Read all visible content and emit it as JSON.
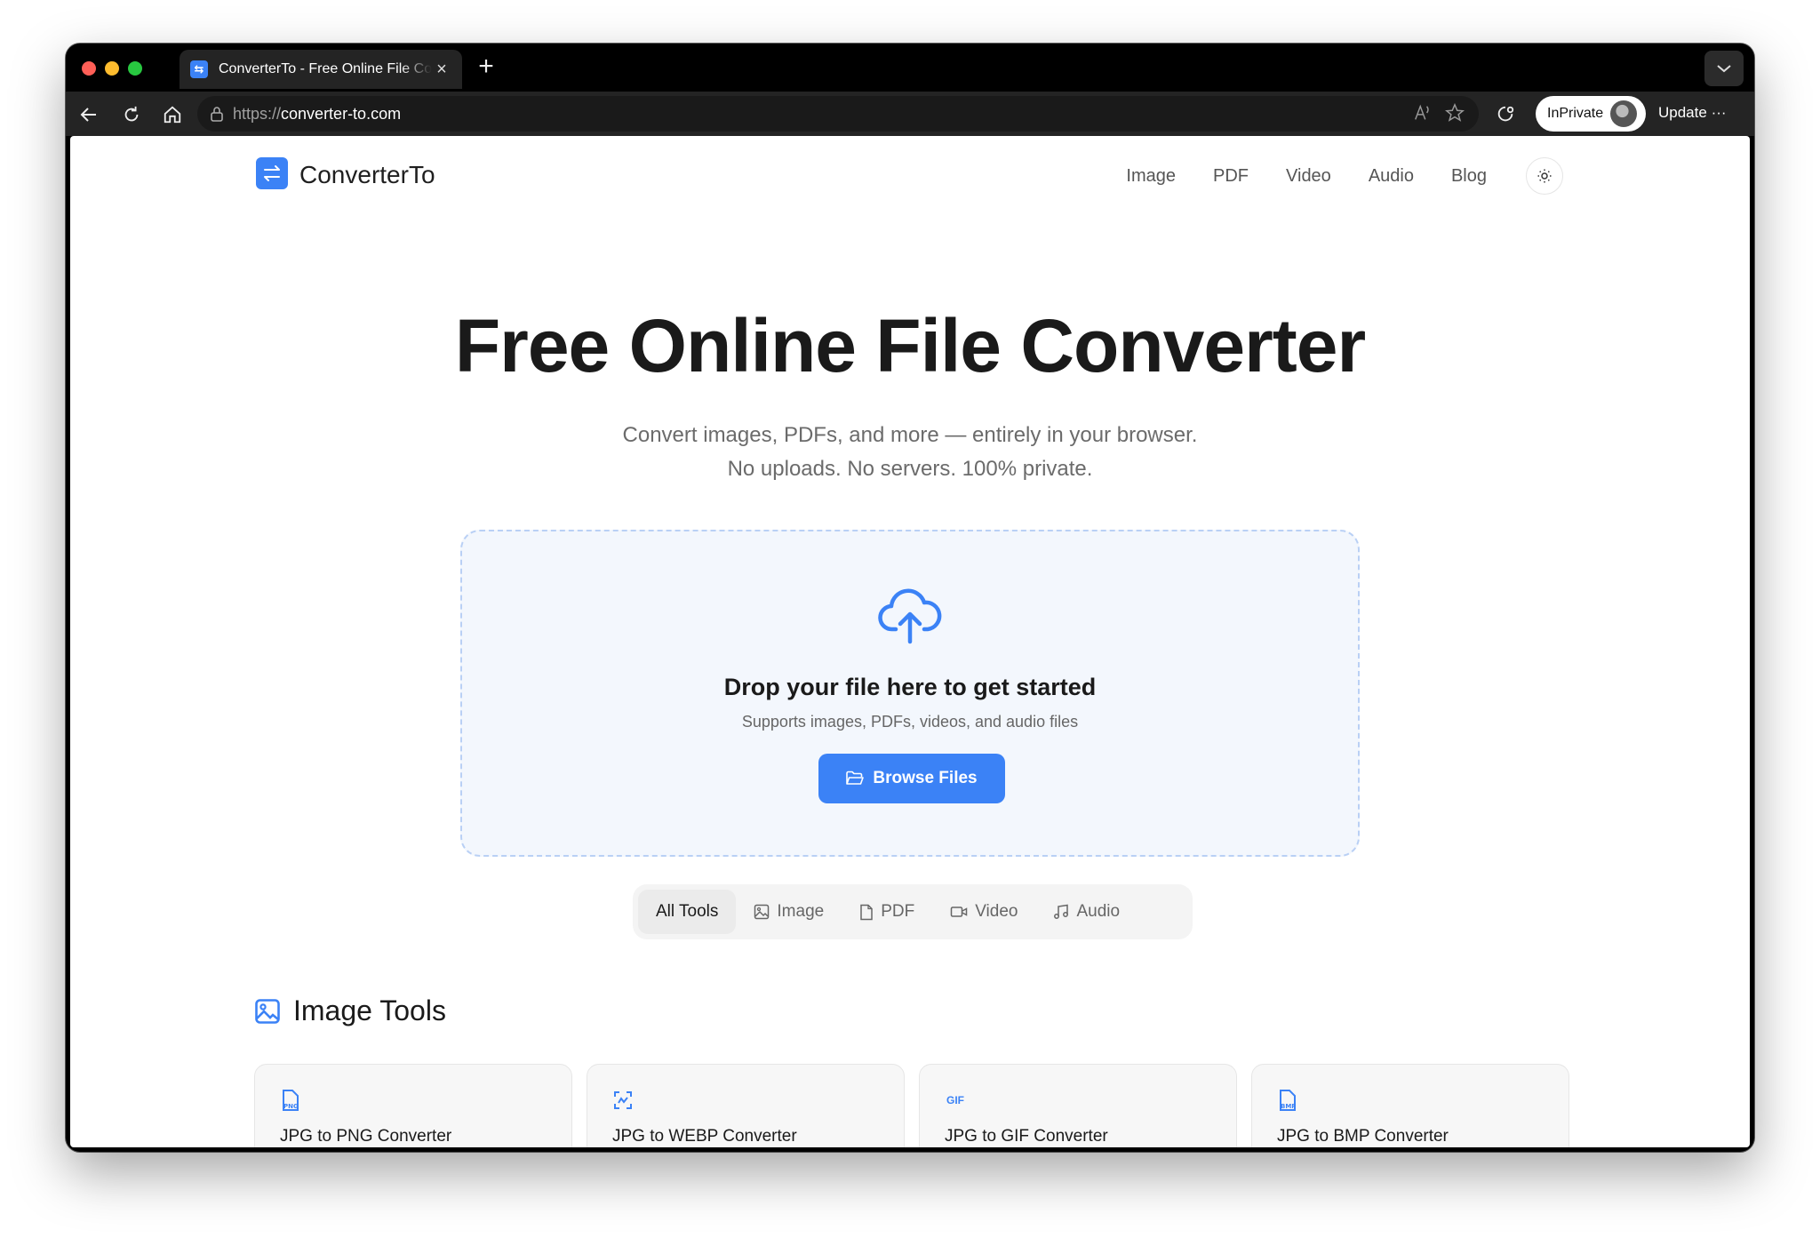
{
  "browser": {
    "tab_title": "ConverterTo - Free Online File Converter",
    "tab_favicon": "⇆",
    "new_tab": "+",
    "url_scheme": "https://",
    "url_host": "converter-to.com",
    "inprivate_label": "InPrivate",
    "update_label": "Update",
    "more": "···"
  },
  "site": {
    "logo_text": "ConverterTo",
    "nav": [
      "Image",
      "PDF",
      "Video",
      "Audio",
      "Blog"
    ]
  },
  "hero": {
    "title": "Free Online File Converter",
    "subtitle_line1": "Convert images, PDFs, and more — entirely in your browser.",
    "subtitle_line2": "No uploads. No servers. 100% private."
  },
  "dropzone": {
    "title": "Drop your file here to get started",
    "subtitle": "Supports images, PDFs, videos, and audio files",
    "button": "Browse Files"
  },
  "filters": [
    {
      "label": "All Tools",
      "icon": "none",
      "active": true
    },
    {
      "label": "Image",
      "icon": "image-icon",
      "active": false
    },
    {
      "label": "PDF",
      "icon": "pdf-file-icon",
      "active": false
    },
    {
      "label": "Video",
      "icon": "video-camera-icon",
      "active": false
    },
    {
      "label": "Audio",
      "icon": "music-note-icon",
      "active": false
    }
  ],
  "section": {
    "title": "Image Tools"
  },
  "tools": [
    {
      "title": "JPG to PNG Converter",
      "badge": "PNG"
    },
    {
      "title": "JPG to WEBP Converter",
      "badge": ""
    },
    {
      "title": "JPG to GIF Converter",
      "badge": "GIF"
    },
    {
      "title": "JPG to BMP Converter",
      "badge": "BMP"
    }
  ],
  "colors": {
    "accent": "#3b82f6",
    "dropzone_bg": "#f3f7fd"
  }
}
